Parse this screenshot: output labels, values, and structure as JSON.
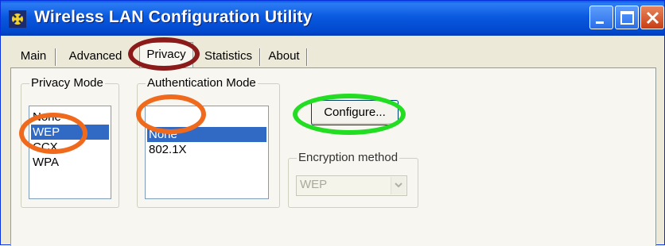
{
  "window": {
    "title": "Wireless LAN Configuration Utility"
  },
  "tabs": [
    {
      "label": "Main"
    },
    {
      "label": "Advanced"
    },
    {
      "label": "Privacy",
      "active": true
    },
    {
      "label": "Statistics"
    },
    {
      "label": "About"
    }
  ],
  "privacy_mode": {
    "title": "Privacy Mode",
    "items": [
      "None",
      "WEP",
      "CCX",
      "WPA"
    ],
    "selected": "WEP"
  },
  "auth_mode": {
    "title": "Authentication Mode",
    "items": [
      "None",
      "802.1X"
    ],
    "selected": "None"
  },
  "configure_button": {
    "label": "Configure..."
  },
  "encryption": {
    "title": "Encryption method",
    "value": "WEP",
    "enabled": false
  },
  "highlight_colors": {
    "privacy_tab": "#8b1a1a",
    "selections": "#f06a1e",
    "configure": "#22dd22"
  }
}
